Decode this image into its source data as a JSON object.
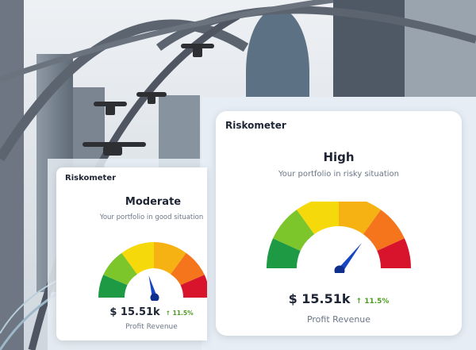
{
  "cards": {
    "back": {
      "title": "Riskometer",
      "level": "Moderate",
      "subtitle": "Your portfolio in good situation",
      "amount": "$ 15.51k",
      "change_arrow": "↑",
      "change": "11.5%",
      "caption": "Profit Revenue",
      "needle_position": "moderate (yellow-orange)"
    },
    "front": {
      "title": "Riskometer",
      "level": "High",
      "subtitle": "Your portfolio in risky situation",
      "amount": "$ 15.51k",
      "change_arrow": "↑",
      "change": "11.5%",
      "caption": "Profit Revenue",
      "needle_position": "high (orange-red)"
    }
  },
  "gauge_colors": [
    "#1e9a45",
    "#7cc52a",
    "#f5d90a",
    "#f6b212",
    "#f4751c",
    "#d8142d"
  ],
  "colors": {
    "text_primary": "#1d2433",
    "text_secondary": "#6a7686",
    "positive": "#4d9c1f",
    "needle": "#1746c4"
  }
}
